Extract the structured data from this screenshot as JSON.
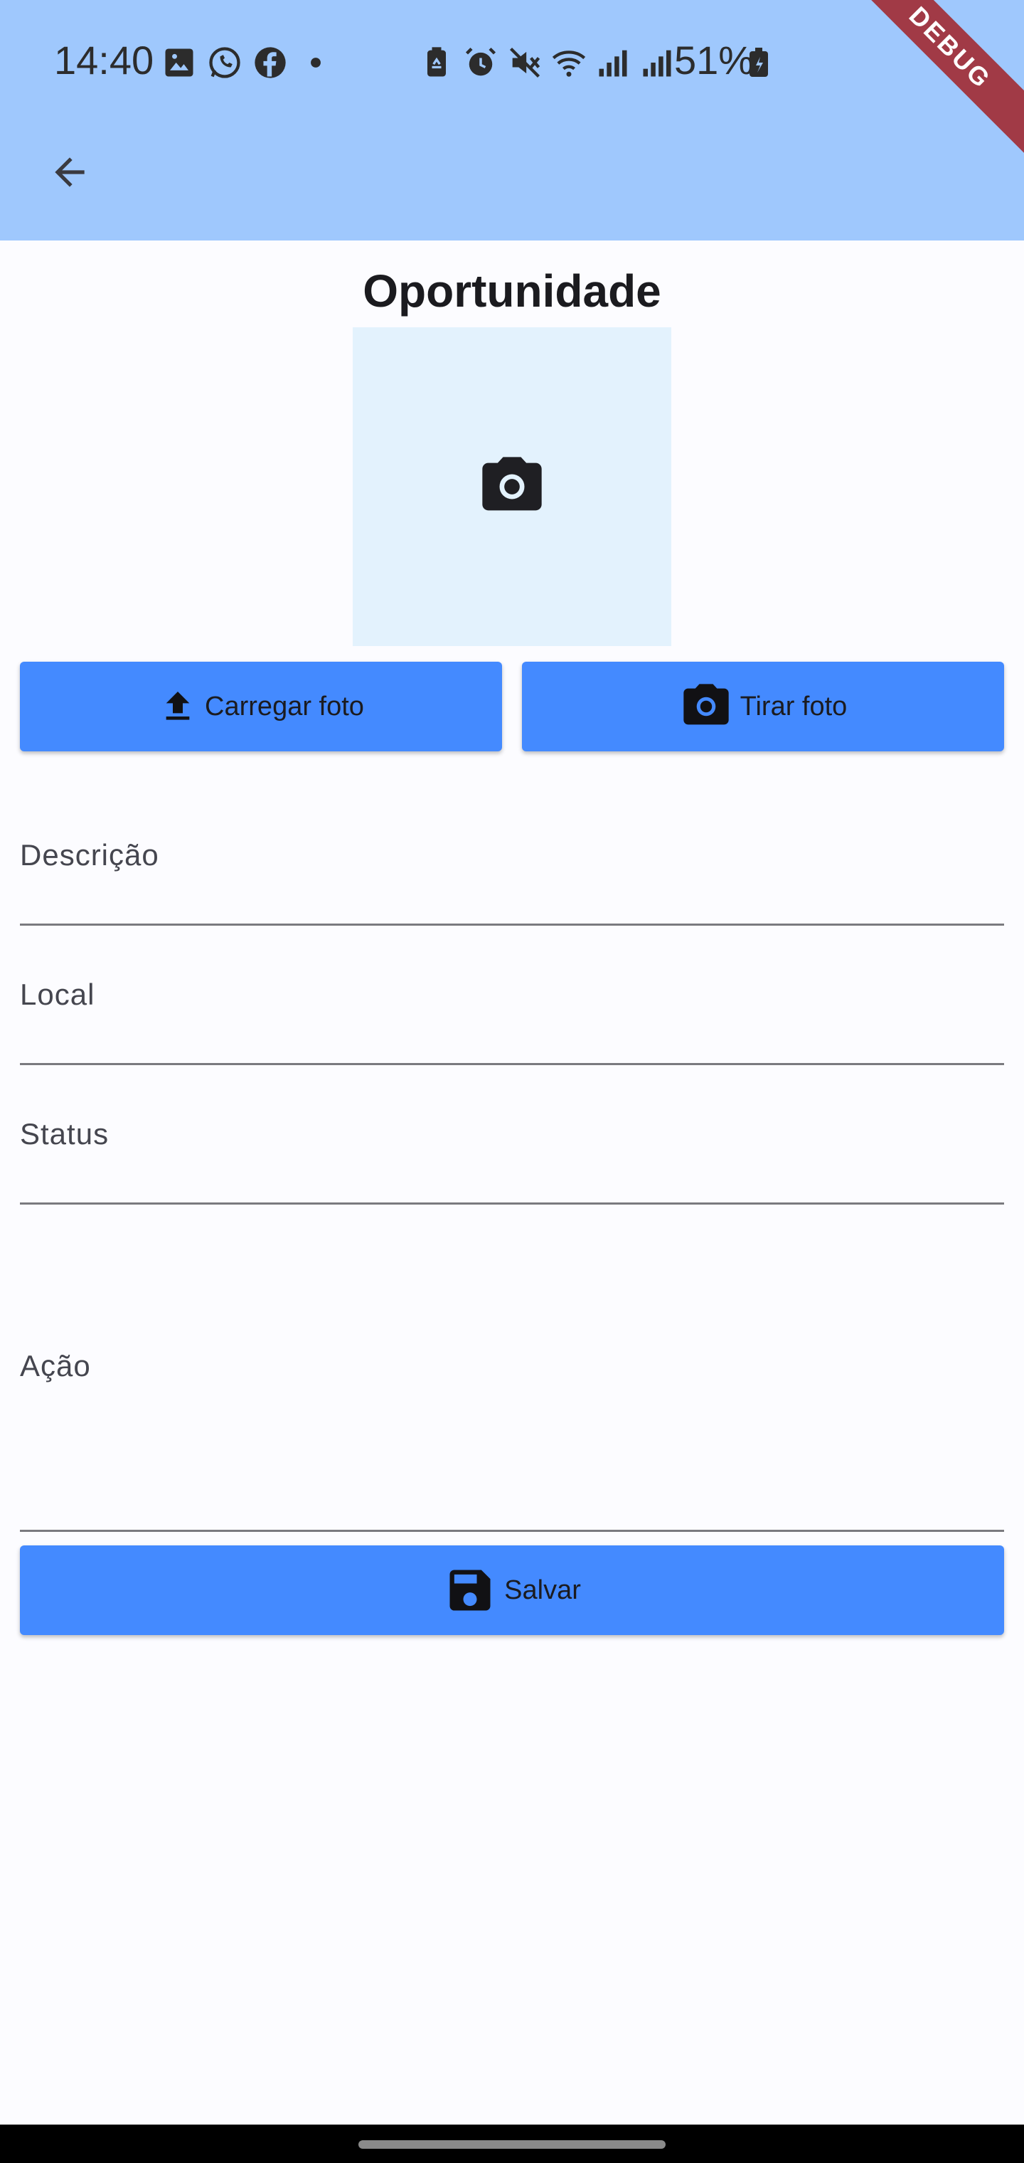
{
  "status_bar": {
    "time": "14:40",
    "battery_percent": "51%",
    "left_icons": [
      "gallery-icon",
      "whatsapp-icon",
      "facebook-icon",
      "dot-icon"
    ],
    "right_icons": [
      "recycle-battery-icon",
      "alarm-icon",
      "mute-icon",
      "wifi-icon",
      "signal-icon",
      "signal-icon"
    ]
  },
  "debug_banner": "DEBUG",
  "app_bar": {
    "back_icon": "arrow-back-icon",
    "color": "#9fc8fd"
  },
  "page": {
    "title": "Oportunidade",
    "photo_placeholder_icon": "camera-icon"
  },
  "buttons": {
    "upload_photo": "Carregar foto",
    "take_photo": "Tirar foto",
    "save": "Salvar",
    "color": "#448aff"
  },
  "form": {
    "descricao_label": "Descrição",
    "local_label": "Local",
    "status_label": "Status",
    "acao_label": "Ação",
    "descricao_value": "",
    "local_value": "",
    "status_value": "",
    "acao_value": ""
  }
}
